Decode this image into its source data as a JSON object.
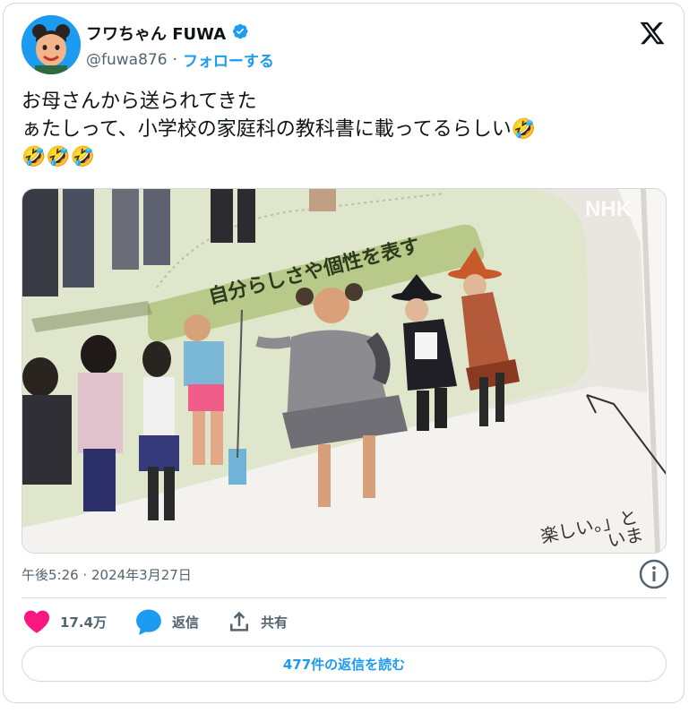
{
  "author": {
    "display_name": "フワちゃん FUWA",
    "handle": "@fuwa876",
    "separator": "·",
    "follow_label": "フォローする",
    "verified": true
  },
  "tweet": {
    "text": "お母さんから送られてきた\nぁたしって、小学校の家庭科の教科書に載ってるらしい🤣\n🤣🤣🤣",
    "timestamp": "午後5:26 · 2024年3月27日"
  },
  "media": {
    "banner_text": "自分らしさや個性を表す",
    "watermark": "NHK",
    "page_text_1": "楽しい。」と",
    "page_text_2": "いま"
  },
  "actions": {
    "like_count": "17.4万",
    "reply_label": "返信",
    "share_label": "共有"
  },
  "read_replies_label": "477件の返信を読む",
  "colors": {
    "accent": "#1d9bf0",
    "like": "#f91880",
    "secondary_text": "#536471",
    "border": "#cfd9de"
  },
  "icons": [
    "verified-badge-icon",
    "x-logo-icon",
    "info-icon",
    "heart-icon",
    "reply-icon",
    "share-icon"
  ]
}
